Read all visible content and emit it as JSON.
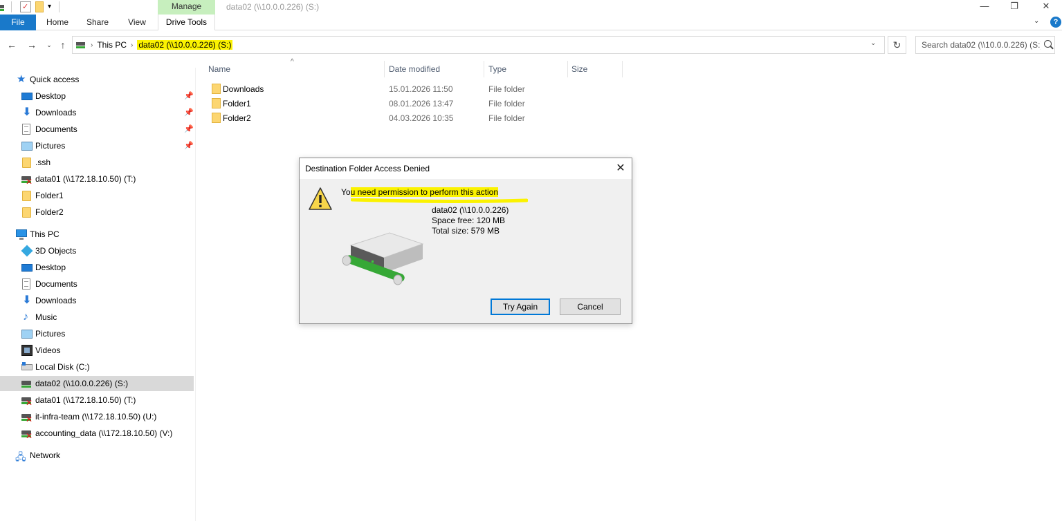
{
  "window": {
    "title": "data02 (\\\\10.0.0.226) (S:)",
    "contextual_tab_group": "Manage",
    "controls": {
      "minimize": "—",
      "restore": "❐",
      "close": "✕"
    }
  },
  "ribbon": {
    "tabs": [
      "File",
      "Home",
      "Share",
      "View",
      "Drive Tools"
    ],
    "help": "?"
  },
  "address_bar": {
    "crumbs": [
      "This PC",
      "data02 (\\\\10.0.0.226) (S:)"
    ],
    "highlight_color": "#fbf200"
  },
  "search": {
    "placeholder": "Search data02 (\\\\10.0.0.226) (S:)"
  },
  "nav_pane": {
    "quick_access_label": "Quick access",
    "quick_access": [
      {
        "label": "Desktop",
        "icon": "desktop-icon",
        "pinned": true
      },
      {
        "label": "Downloads",
        "icon": "downloads-icon",
        "pinned": true
      },
      {
        "label": "Documents",
        "icon": "documents-icon",
        "pinned": true
      },
      {
        "label": "Pictures",
        "icon": "pictures-icon",
        "pinned": true
      },
      {
        "label": ".ssh",
        "icon": "folder-icon",
        "pinned": false
      },
      {
        "label": "data01 (\\\\172.18.10.50) (T:)",
        "icon": "disconnected-drive-icon",
        "pinned": false
      },
      {
        "label": "Folder1",
        "icon": "folder-icon",
        "pinned": false
      },
      {
        "label": "Folder2",
        "icon": "folder-icon",
        "pinned": false
      }
    ],
    "this_pc_label": "This PC",
    "this_pc": [
      {
        "label": "3D Objects",
        "icon": "3d-objects-icon"
      },
      {
        "label": "Desktop",
        "icon": "desktop-icon"
      },
      {
        "label": "Documents",
        "icon": "documents-icon"
      },
      {
        "label": "Downloads",
        "icon": "downloads-icon"
      },
      {
        "label": "Music",
        "icon": "music-icon"
      },
      {
        "label": "Pictures",
        "icon": "pictures-icon"
      },
      {
        "label": "Videos",
        "icon": "videos-icon"
      },
      {
        "label": "Local Disk (C:)",
        "icon": "local-disk-icon"
      },
      {
        "label": "data02 (\\\\10.0.0.226) (S:)",
        "icon": "network-drive-icon",
        "selected": true
      },
      {
        "label": "data01 (\\\\172.18.10.50) (T:)",
        "icon": "disconnected-drive-icon"
      },
      {
        "label": "it-infra-team (\\\\172.18.10.50) (U:)",
        "icon": "disconnected-drive-icon"
      },
      {
        "label": "accounting_data (\\\\172.18.10.50) (V:)",
        "icon": "disconnected-drive-icon"
      }
    ],
    "network_label": "Network"
  },
  "file_list": {
    "columns": [
      "Name",
      "Date modified",
      "Type",
      "Size"
    ],
    "rows": [
      {
        "name": "Downloads",
        "date": "15.01.2026 11:50",
        "type": "File folder",
        "size": ""
      },
      {
        "name": "Folder1",
        "date": "08.01.2026 13:47",
        "type": "File folder",
        "size": ""
      },
      {
        "name": "Folder2",
        "date": "04.03.2026 10:35",
        "type": "File folder",
        "size": ""
      }
    ]
  },
  "dialog": {
    "title": "Destination Folder Access Denied",
    "message_prefix": "Yo",
    "message_highlighted": "u need permission to perform this action",
    "drive_name": "data02 (\\\\10.0.0.226)",
    "space_free": "Space free: 120 MB",
    "total_size": "Total size: 579 MB",
    "try_again_label": "Try Again",
    "cancel_label": "Cancel",
    "close": "✕"
  }
}
